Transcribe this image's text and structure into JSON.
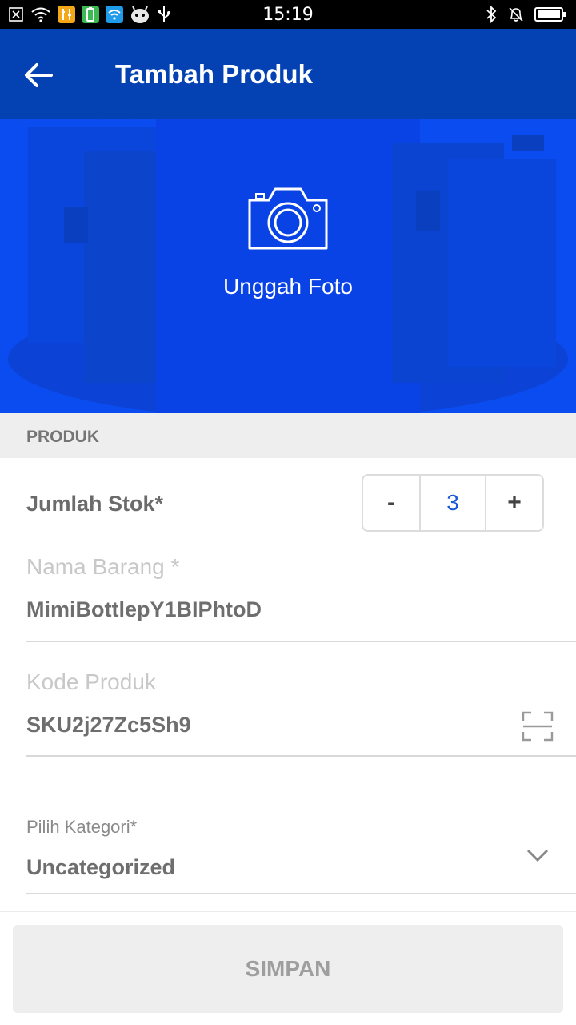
{
  "status_bar": {
    "time": "15:19"
  },
  "header": {
    "title": "Tambah Produk"
  },
  "hero": {
    "upload_label": "Unggah Foto"
  },
  "section": {
    "title": "PRODUK"
  },
  "stock": {
    "label": "Jumlah Stok*",
    "minus": "-",
    "value": "3",
    "plus": "+"
  },
  "name_field": {
    "label": "Nama Barang *",
    "value": "MimiBottlepY1BIPhtoD"
  },
  "code_field": {
    "label": "Kode Produk",
    "value": "SKU2j27Zc5Sh9"
  },
  "category_field": {
    "label": "Pilih Kategori*",
    "value": "Uncategorized"
  },
  "footer": {
    "save_label": "SIMPAN"
  },
  "colors": {
    "primary_dark": "#0442b4",
    "hero_blue": "#0a4cf0",
    "accent_value": "#1a5ad8"
  }
}
